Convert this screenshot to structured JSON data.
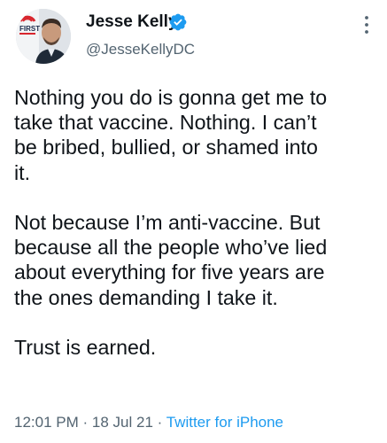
{
  "author": {
    "name": "Jesse Kelly",
    "handle": "@JesseKellyDC",
    "avatar_badge_text": "FIRST",
    "verified_color": "#1d9bf0"
  },
  "icons": {
    "verified": "verified-badge-icon",
    "more": "more-options-icon"
  },
  "tweet": {
    "paragraphs": [
      {
        "lines": [
          "Nothing you do is gonna get me to",
          "take that vaccine. Nothing. I can’t",
          "be bribed, bullied, or shamed into",
          "it."
        ]
      },
      {
        "lines": [
          "Not because I’m anti-vaccine. But",
          "because all the people who’ve lied",
          "about everything for five years are",
          "the ones demanding I take it."
        ]
      },
      {
        "lines": [
          "Trust is earned."
        ]
      }
    ]
  },
  "meta": {
    "time": "12:01 PM",
    "separator": "·",
    "date": "18 Jul 21",
    "source": "Twitter for iPhone"
  },
  "colors": {
    "text": "#0f1419",
    "secondary": "#536471",
    "accent": "#1d9bf0"
  }
}
